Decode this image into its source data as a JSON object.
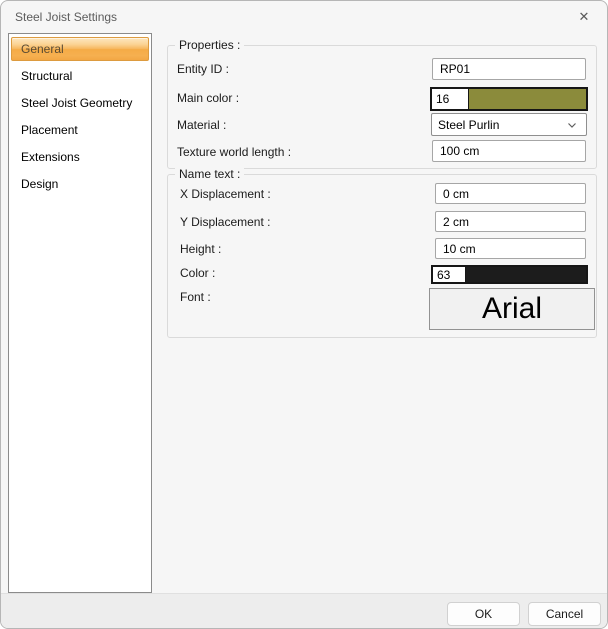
{
  "window": {
    "title": "Steel Joist Settings",
    "close_glyph": "✕"
  },
  "sidebar": {
    "selected_index": 0,
    "items": [
      "General",
      "Structural",
      "Steel Joist Geometry",
      "Placement",
      "Extensions",
      "Design"
    ]
  },
  "properties_group": {
    "legend": "Properties :",
    "entity_id": {
      "label": "Entity ID :",
      "value": "RP01"
    },
    "main_color": {
      "label": "Main color :",
      "number": "16",
      "swatch_color": "#8b8b3b"
    },
    "material": {
      "label": "Material :",
      "value": "Steel Purlin"
    },
    "texture_world_length": {
      "label": "Texture world length :",
      "value": "100 cm"
    }
  },
  "name_text_group": {
    "legend": "Name text :",
    "x_displacement": {
      "label": "X Displacement :",
      "value": "0 cm"
    },
    "y_displacement": {
      "label": "Y Displacement :",
      "value": "2 cm"
    },
    "height": {
      "label": "Height :",
      "value": "10 cm"
    },
    "color": {
      "label": "Color :",
      "number": "63",
      "swatch_color": "#1c1c1c"
    },
    "font": {
      "label": "Font :",
      "value": "Arial"
    }
  },
  "footer": {
    "ok_label": "OK",
    "cancel_label": "Cancel"
  }
}
